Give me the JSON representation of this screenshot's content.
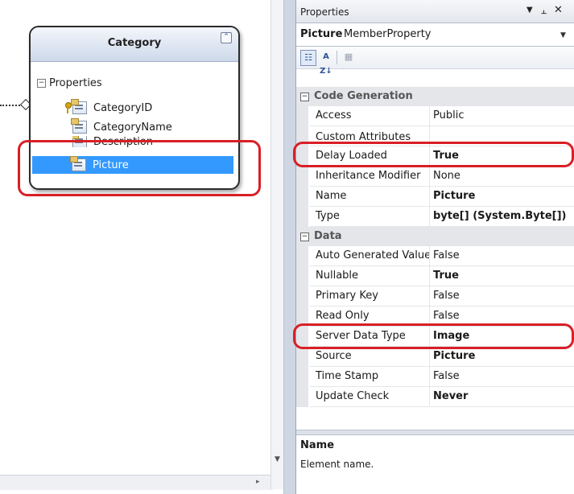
{
  "designer": {
    "entity": {
      "title": "Category",
      "section_label": "Properties",
      "properties": [
        "CategoryID",
        "CategoryName",
        "Description",
        "Picture"
      ],
      "selected": "Picture"
    },
    "icons": {
      "collapse": "double-chevron-up-icon",
      "key": "primary-key-icon",
      "property": "property-icon",
      "association_end": "association-diamond-icon"
    }
  },
  "properties_window": {
    "title": "Properties",
    "object_name": "Picture",
    "object_type": "MemberProperty",
    "toolbar": {
      "categorized_label": "☷",
      "alphabetical_label": "A Z↓",
      "property_pages_label": "▦"
    },
    "categories": [
      {
        "label": "Code Generation",
        "rows": [
          {
            "name": "Access",
            "value": "Public",
            "bold": false
          },
          {
            "name": "Custom Attributes",
            "value": "",
            "bold": false
          },
          {
            "name": "Delay Loaded",
            "value": "True",
            "bold": true
          },
          {
            "name": "Inheritance Modifier",
            "value": "None",
            "bold": false
          },
          {
            "name": "Name",
            "value": "Picture",
            "bold": true
          },
          {
            "name": "Type",
            "value": "byte[] (System.Byte[])",
            "bold": true
          }
        ]
      },
      {
        "label": "Data",
        "rows": [
          {
            "name": "Auto Generated Value",
            "value": "False",
            "bold": false
          },
          {
            "name": "Nullable",
            "value": "True",
            "bold": true
          },
          {
            "name": "Primary Key",
            "value": "False",
            "bold": false
          },
          {
            "name": "Read Only",
            "value": "False",
            "bold": false
          },
          {
            "name": "Server Data Type",
            "value": "Image",
            "bold": true
          },
          {
            "name": "Source",
            "value": "Picture",
            "bold": true
          },
          {
            "name": "Time Stamp",
            "value": "False",
            "bold": false
          },
          {
            "name": "Update Check",
            "value": "Never",
            "bold": true
          }
        ]
      }
    ],
    "description": {
      "title": "Name",
      "text": "Element name."
    }
  },
  "colors": {
    "selection": "#3399ff",
    "highlight_ring": "#d91f26",
    "category_band": "#e4e6ea"
  }
}
